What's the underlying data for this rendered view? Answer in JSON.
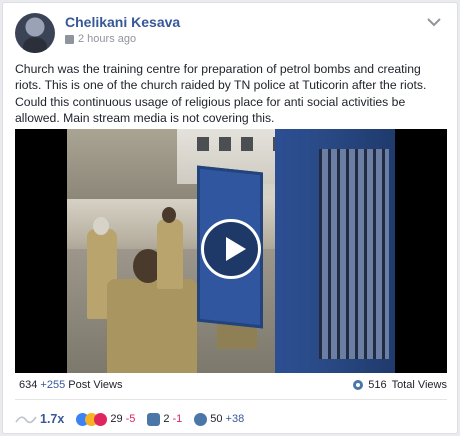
{
  "post": {
    "author": "Chelikani Kesava",
    "time": "2 hours ago",
    "text": "Church was the training centre for preparation of petrol bombs and creating riots. This is one of the church raided by TN police at Tuticorin after the riots. Could this continuous usage of religious place for anti social activities be allowed. Main stream media is not covering this."
  },
  "views": {
    "post_views": "634",
    "post_views_delta": "+255",
    "post_views_label": "Post Views",
    "total_views": "516",
    "total_views_label": "Total Views"
  },
  "stats": {
    "ratio": "1.7x",
    "reactions": "29",
    "reactions_delta": "-5",
    "comments": "2",
    "comments_delta": "-1",
    "shares": "50",
    "shares_delta": "+38"
  },
  "colors": {
    "link": "#365899",
    "negative": "#e0245e",
    "video_bg": "#000000"
  }
}
